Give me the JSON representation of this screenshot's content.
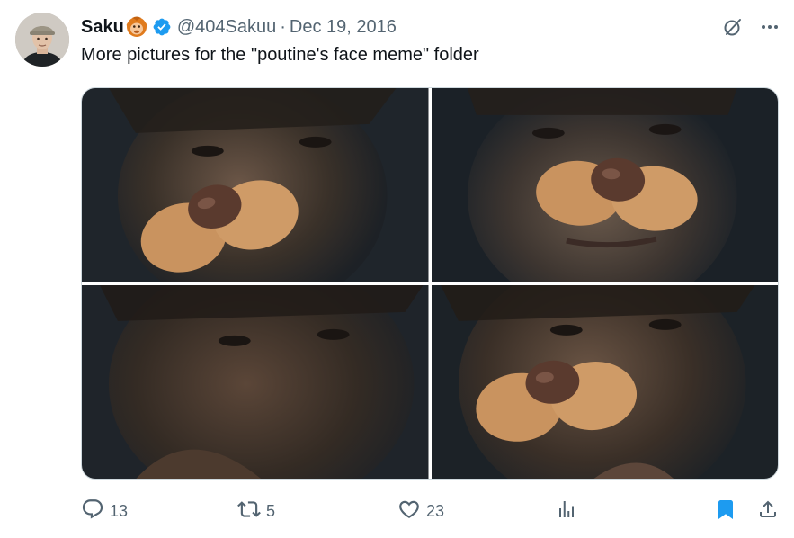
{
  "tweet": {
    "author": {
      "display_name": "Saku",
      "name_emoji": "orangutan-emoji",
      "verified": true,
      "handle": "@404Sakuu",
      "separator": "·",
      "date": "Dec 19, 2016"
    },
    "text": "More pictures for the \"poutine's face meme\" folder",
    "media": [
      {
        "alt": "photo-1",
        "filter": "dog-nose"
      },
      {
        "alt": "photo-2",
        "filter": "dog-nose"
      },
      {
        "alt": "photo-3",
        "filter": "none"
      },
      {
        "alt": "photo-4",
        "filter": "dog-nose"
      }
    ],
    "actions": {
      "replies": "13",
      "reposts": "5",
      "likes": "23",
      "views": "",
      "bookmarked": true
    },
    "top_icons": [
      "grok-icon",
      "more-icon"
    ]
  },
  "colors": {
    "text_primary": "#0f1419",
    "text_secondary": "#536471",
    "verified_blue": "#1d9bf0",
    "bookmark_blue": "#1d9bf0"
  }
}
